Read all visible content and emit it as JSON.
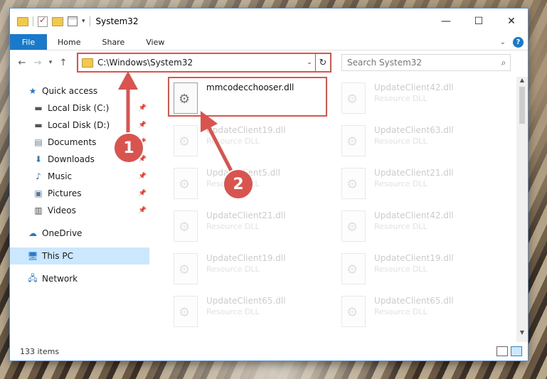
{
  "window": {
    "title": "System32"
  },
  "ribbon": {
    "tabs": [
      "File",
      "Home",
      "Share",
      "View"
    ]
  },
  "address": {
    "path": "C:\\Windows\\System32"
  },
  "search": {
    "placeholder": "Search System32"
  },
  "nav": {
    "items": [
      {
        "label": "Quick access",
        "icon": "star-icon",
        "pinned": false
      },
      {
        "label": "Local Disk (C:)",
        "icon": "drive-icon",
        "pinned": true
      },
      {
        "label": "Local Disk (D:)",
        "icon": "drive-icon",
        "pinned": true
      },
      {
        "label": "Documents",
        "icon": "documents-icon",
        "pinned": true
      },
      {
        "label": "Downloads",
        "icon": "download-icon",
        "pinned": true
      },
      {
        "label": "Music",
        "icon": "music-icon",
        "pinned": true
      },
      {
        "label": "Pictures",
        "icon": "pictures-icon",
        "pinned": true
      },
      {
        "label": "Videos",
        "icon": "videos-icon",
        "pinned": true
      },
      {
        "label": "OneDrive",
        "icon": "cloud-icon"
      },
      {
        "label": "This PC",
        "icon": "computer-icon",
        "selected": true
      },
      {
        "label": "Network",
        "icon": "network-icon"
      }
    ]
  },
  "files": [
    {
      "name": "mmcodecchooser.dll",
      "type": ""
    },
    {
      "name": "UpdateClient42.dll",
      "type": "Resource DLL"
    },
    {
      "name": "UpdateClient19.dll",
      "type": "Resource DLL"
    },
    {
      "name": "UpdateClient63.dll",
      "type": "Resource DLL"
    },
    {
      "name": "UpdateClient5.dll",
      "type": "Resource DLL"
    },
    {
      "name": "UpdateClient21.dll",
      "type": "Resource DLL"
    },
    {
      "name": "UpdateClient21.dll",
      "type": "Resource DLL"
    },
    {
      "name": "UpdateClient42.dll",
      "type": "Resource DLL"
    },
    {
      "name": "UpdateClient19.dll",
      "type": "Resource DLL"
    },
    {
      "name": "UpdateClient19.dll",
      "type": "Resource DLL"
    },
    {
      "name": "UpdateClient65.dll",
      "type": "Resource DLL"
    },
    {
      "name": "UpdateClient65.dll",
      "type": "Resource DLL"
    }
  ],
  "status": {
    "count": "133 items"
  },
  "annotations": {
    "step1": "1",
    "step2": "2",
    "color": "#d9534f"
  }
}
